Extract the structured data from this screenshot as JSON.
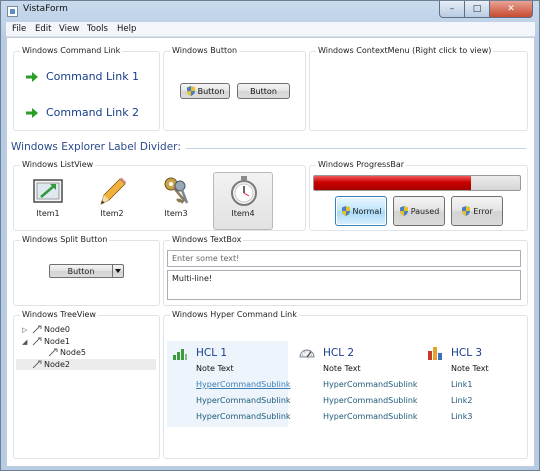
{
  "window": {
    "title": "VistaForm"
  },
  "caption": {
    "minimize": "–",
    "maximize": "□",
    "close": "✕"
  },
  "menu": [
    "File",
    "Edit",
    "View",
    "Tools",
    "Help"
  ],
  "command_link": {
    "title": "Windows Command Link",
    "links": [
      "Command Link 1",
      "Command Link 2"
    ]
  },
  "windows_button": {
    "title": "Windows Button",
    "buttons": [
      "Button",
      "Button"
    ]
  },
  "context_menu": {
    "title": "Windows ContextMenu (Right click to view)"
  },
  "explorer_divider": {
    "label": "Windows Explorer Label Divider:"
  },
  "list_view": {
    "title": "Windows ListView",
    "items": [
      "Item1",
      "Item2",
      "Item3",
      "Item4"
    ],
    "selected_index": 3
  },
  "progress_bar": {
    "title": "Windows ProgressBar",
    "value_percent": 76,
    "color": "#cc0000",
    "buttons": [
      "Normal",
      "Paused",
      "Error"
    ]
  },
  "split_button": {
    "title": "Windows Split Button",
    "label": "Button"
  },
  "text_box": {
    "title": "Windows TextBox",
    "placeholder": "Enter some text!",
    "multiline_value": "Multi-line!"
  },
  "tree_view": {
    "title": "Windows TreeView",
    "nodes": [
      "Node0",
      "Node1",
      "Node5",
      "Node2"
    ]
  },
  "hyper_command_link": {
    "title": "Windows Hyper Command Link",
    "columns": [
      {
        "heading": "HCL 1",
        "note": "Note Text",
        "links": [
          "HyperCommandSublink",
          "HyperCommandSublink",
          "HyperCommandSublink"
        ]
      },
      {
        "heading": "HCL 2",
        "note": "Note Text",
        "links": [
          "HyperCommandSublink",
          "HyperCommandSublink",
          "HyperCommandSublink"
        ]
      },
      {
        "heading": "HCL 3",
        "note": "Note Text",
        "links": [
          "Link1",
          "Link2",
          "Link3"
        ]
      }
    ]
  }
}
